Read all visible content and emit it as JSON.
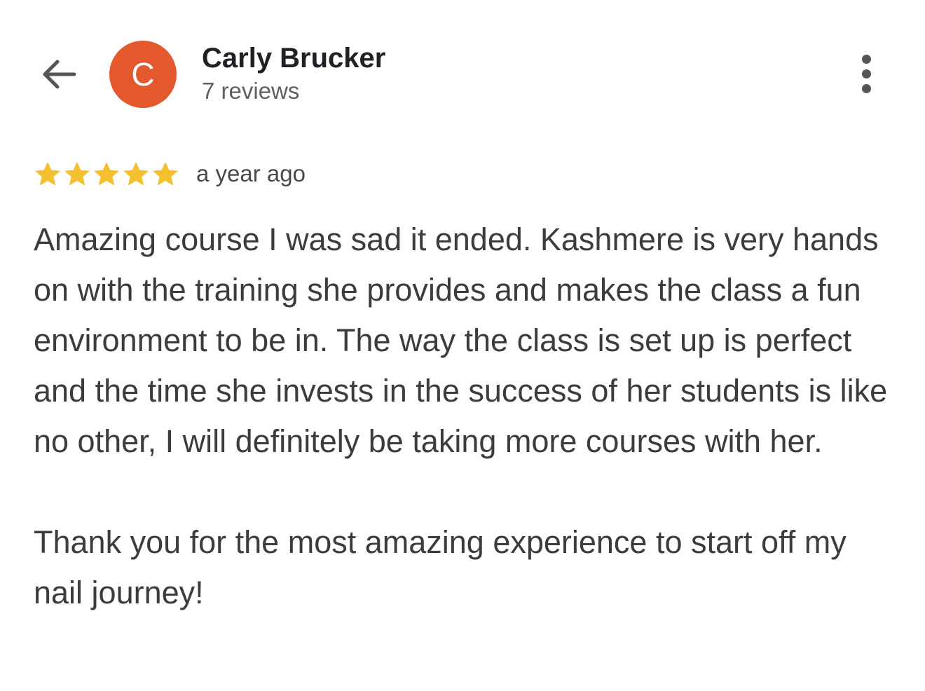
{
  "header": {
    "back_icon": "arrow-left-icon",
    "avatar_letter": "C",
    "avatar_color": "#e4582e",
    "name": "Carly Brucker",
    "review_count": "7 reviews",
    "more_icon": "more-vertical-icon"
  },
  "review": {
    "rating": 5,
    "max_rating": 5,
    "star_color": "#f4c02f",
    "time": "a year ago",
    "paragraph_1": "Amazing course I was sad it ended. Kashmere is very hands on with the training she provides and makes the class a fun environment to be in. The way the class is set up is perfect and the time she invests in the success of her students is like no other, I will definitely be taking more courses with her.",
    "paragraph_2": "Thank you for the most amazing experience to start off my nail journey!"
  }
}
